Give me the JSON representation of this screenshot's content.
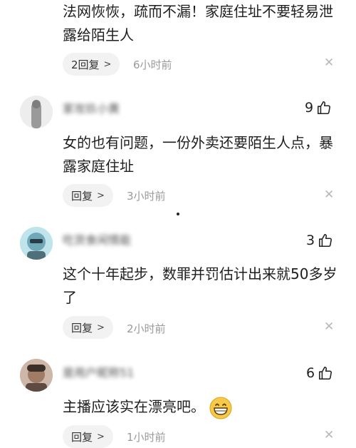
{
  "comment_top": {
    "text": "法网恢恢，疏而不漏！家庭住址不要轻易泄露给陌生人",
    "reply_label": "2回复",
    "time": "6小时前"
  },
  "comments": [
    {
      "username": "家攻玖小黄",
      "likes": "9",
      "text": "女的也有问题，一份外卖还要陌生人点，暴露家庭住址",
      "reply_label": "回复",
      "time": "3小时前"
    },
    {
      "username": "吃货食闲情能",
      "likes": "3",
      "text": "这个十年起步，数罪并罚估计出来就50多岁了",
      "reply_label": "回复",
      "time": "2小时前"
    },
    {
      "username": "是用户昵称51",
      "likes": "6",
      "text": "主播应该实在漂亮吧。",
      "reply_label": "回复",
      "time": "1小时前"
    }
  ],
  "icons": {
    "like": "thumbs-up-icon",
    "close": "close-icon",
    "chevron": "chevron-right-icon",
    "emoji": "grinning-face-emoji"
  }
}
